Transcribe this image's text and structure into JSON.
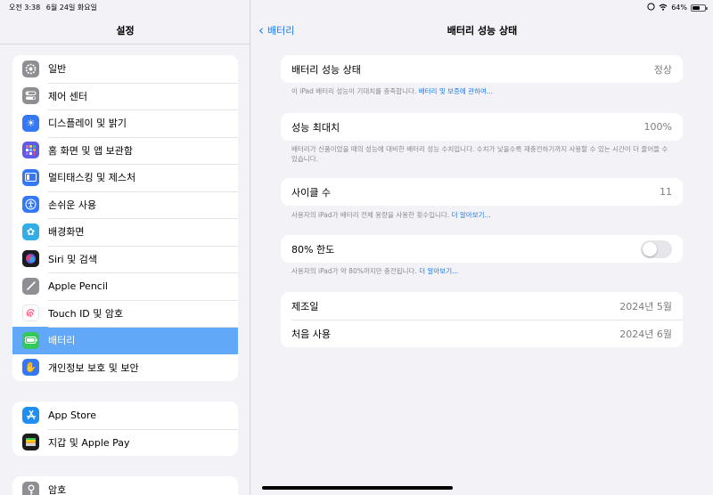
{
  "status_bar": {
    "time": "오전 3:38",
    "date": "6월 24일 화요일",
    "battery_percent": "64%",
    "battery_level": 0.64
  },
  "sidebar": {
    "title": "설정",
    "groups": [
      {
        "items": [
          {
            "label": "일반",
            "icon": "gear-icon",
            "color": "#8e8e93"
          },
          {
            "label": "제어 센터",
            "icon": "control-center-icon",
            "color": "#8e8e93"
          },
          {
            "label": "디스플레이 및 밝기",
            "icon": "brightness-icon",
            "color": "#3478f6"
          },
          {
            "label": "홈 화면 및 앱 보관함",
            "icon": "home-screen-icon",
            "color": "#5e5ce6"
          },
          {
            "label": "멀티태스킹 및 제스처",
            "icon": "multitasking-icon",
            "color": "#3478f6"
          },
          {
            "label": "손쉬운 사용",
            "icon": "accessibility-icon",
            "color": "#3478f6"
          },
          {
            "label": "배경화면",
            "icon": "wallpaper-icon",
            "color": "#32ade6"
          },
          {
            "label": "Siri 및 검색",
            "icon": "siri-icon",
            "color": "#1c1c1e"
          },
          {
            "label": "Apple Pencil",
            "icon": "pencil-icon",
            "color": "#8e8e93"
          },
          {
            "label": "Touch ID 및 암호",
            "icon": "fingerprint-icon",
            "color": "#ffffff"
          },
          {
            "label": "배터리",
            "icon": "battery-icon",
            "color": "#34c759",
            "selected": true
          },
          {
            "label": "개인정보 보호 및 보안",
            "icon": "hand-icon",
            "color": "#3478f6"
          }
        ]
      },
      {
        "items": [
          {
            "label": "App Store",
            "icon": "app-store-icon",
            "color": "#1f8ef1"
          },
          {
            "label": "지갑 및 Apple Pay",
            "icon": "wallet-icon",
            "color": "#1c1c1e"
          }
        ]
      },
      {
        "items": [
          {
            "label": "암호",
            "icon": "key-icon",
            "color": "#8e8e93"
          }
        ]
      }
    ]
  },
  "main": {
    "back_label": "배터리",
    "title": "배터리 성능 상태",
    "health": {
      "label": "배터리 성능 상태",
      "value": "정상",
      "footnote": "이 iPad 배터리 성능이 기대치를 충족합니다.",
      "footnote_link": "배터리 및 보증에 관하여..."
    },
    "max_capacity": {
      "label": "성능 최대치",
      "value": "100%",
      "footnote": "배터리가 신품이었을 때의 성능에 대비한 배터리 성능 수치입니다. 수치가 낮을수록 재충전하기까지 사용할 수 있는 시간이 더 줄어들 수 있습니다."
    },
    "cycle_count": {
      "label": "사이클 수",
      "value": "11",
      "footnote": "사용자의 iPad가 배터리 전체 용량을 사용한 횟수입니다.",
      "footnote_link": "더 알아보기..."
    },
    "limit_80": {
      "label": "80% 한도",
      "enabled": false,
      "footnote": "사용자의 iPad가 약 80%까지만 충전됩니다.",
      "footnote_link": "더 알아보기..."
    },
    "dates": {
      "manufacture_label": "제조일",
      "manufacture_value": "2024년 5월",
      "first_use_label": "처음 사용",
      "first_use_value": "2024년 6월"
    }
  }
}
